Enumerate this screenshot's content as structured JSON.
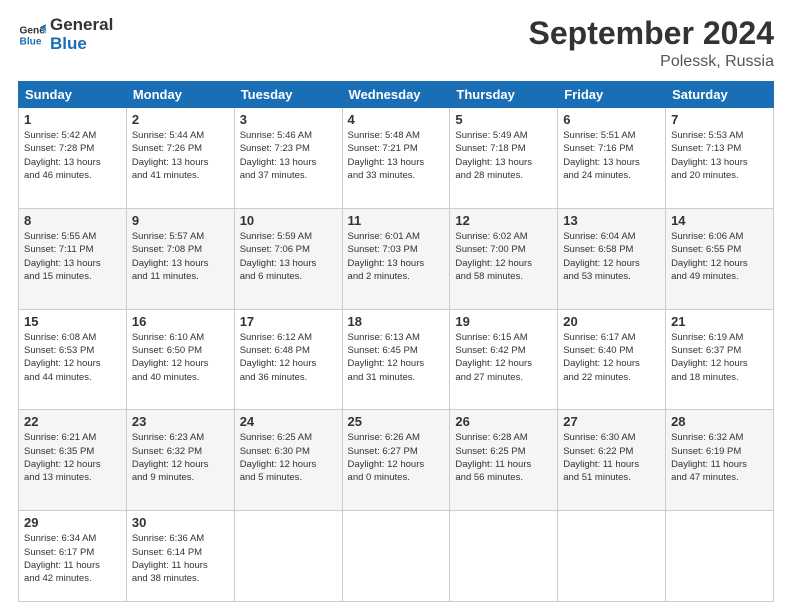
{
  "logo": {
    "line1": "General",
    "line2": "Blue"
  },
  "title": "September 2024",
  "location": "Polessk, Russia",
  "days_of_week": [
    "Sunday",
    "Monday",
    "Tuesday",
    "Wednesday",
    "Thursday",
    "Friday",
    "Saturday"
  ],
  "weeks": [
    [
      {
        "day": "1",
        "info": "Sunrise: 5:42 AM\nSunset: 7:28 PM\nDaylight: 13 hours\nand 46 minutes."
      },
      {
        "day": "2",
        "info": "Sunrise: 5:44 AM\nSunset: 7:26 PM\nDaylight: 13 hours\nand 41 minutes."
      },
      {
        "day": "3",
        "info": "Sunrise: 5:46 AM\nSunset: 7:23 PM\nDaylight: 13 hours\nand 37 minutes."
      },
      {
        "day": "4",
        "info": "Sunrise: 5:48 AM\nSunset: 7:21 PM\nDaylight: 13 hours\nand 33 minutes."
      },
      {
        "day": "5",
        "info": "Sunrise: 5:49 AM\nSunset: 7:18 PM\nDaylight: 13 hours\nand 28 minutes."
      },
      {
        "day": "6",
        "info": "Sunrise: 5:51 AM\nSunset: 7:16 PM\nDaylight: 13 hours\nand 24 minutes."
      },
      {
        "day": "7",
        "info": "Sunrise: 5:53 AM\nSunset: 7:13 PM\nDaylight: 13 hours\nand 20 minutes."
      }
    ],
    [
      {
        "day": "8",
        "info": "Sunrise: 5:55 AM\nSunset: 7:11 PM\nDaylight: 13 hours\nand 15 minutes."
      },
      {
        "day": "9",
        "info": "Sunrise: 5:57 AM\nSunset: 7:08 PM\nDaylight: 13 hours\nand 11 minutes."
      },
      {
        "day": "10",
        "info": "Sunrise: 5:59 AM\nSunset: 7:06 PM\nDaylight: 13 hours\nand 6 minutes."
      },
      {
        "day": "11",
        "info": "Sunrise: 6:01 AM\nSunset: 7:03 PM\nDaylight: 13 hours\nand 2 minutes."
      },
      {
        "day": "12",
        "info": "Sunrise: 6:02 AM\nSunset: 7:00 PM\nDaylight: 12 hours\nand 58 minutes."
      },
      {
        "day": "13",
        "info": "Sunrise: 6:04 AM\nSunset: 6:58 PM\nDaylight: 12 hours\nand 53 minutes."
      },
      {
        "day": "14",
        "info": "Sunrise: 6:06 AM\nSunset: 6:55 PM\nDaylight: 12 hours\nand 49 minutes."
      }
    ],
    [
      {
        "day": "15",
        "info": "Sunrise: 6:08 AM\nSunset: 6:53 PM\nDaylight: 12 hours\nand 44 minutes."
      },
      {
        "day": "16",
        "info": "Sunrise: 6:10 AM\nSunset: 6:50 PM\nDaylight: 12 hours\nand 40 minutes."
      },
      {
        "day": "17",
        "info": "Sunrise: 6:12 AM\nSunset: 6:48 PM\nDaylight: 12 hours\nand 36 minutes."
      },
      {
        "day": "18",
        "info": "Sunrise: 6:13 AM\nSunset: 6:45 PM\nDaylight: 12 hours\nand 31 minutes."
      },
      {
        "day": "19",
        "info": "Sunrise: 6:15 AM\nSunset: 6:42 PM\nDaylight: 12 hours\nand 27 minutes."
      },
      {
        "day": "20",
        "info": "Sunrise: 6:17 AM\nSunset: 6:40 PM\nDaylight: 12 hours\nand 22 minutes."
      },
      {
        "day": "21",
        "info": "Sunrise: 6:19 AM\nSunset: 6:37 PM\nDaylight: 12 hours\nand 18 minutes."
      }
    ],
    [
      {
        "day": "22",
        "info": "Sunrise: 6:21 AM\nSunset: 6:35 PM\nDaylight: 12 hours\nand 13 minutes."
      },
      {
        "day": "23",
        "info": "Sunrise: 6:23 AM\nSunset: 6:32 PM\nDaylight: 12 hours\nand 9 minutes."
      },
      {
        "day": "24",
        "info": "Sunrise: 6:25 AM\nSunset: 6:30 PM\nDaylight: 12 hours\nand 5 minutes."
      },
      {
        "day": "25",
        "info": "Sunrise: 6:26 AM\nSunset: 6:27 PM\nDaylight: 12 hours\nand 0 minutes."
      },
      {
        "day": "26",
        "info": "Sunrise: 6:28 AM\nSunset: 6:25 PM\nDaylight: 11 hours\nand 56 minutes."
      },
      {
        "day": "27",
        "info": "Sunrise: 6:30 AM\nSunset: 6:22 PM\nDaylight: 11 hours\nand 51 minutes."
      },
      {
        "day": "28",
        "info": "Sunrise: 6:32 AM\nSunset: 6:19 PM\nDaylight: 11 hours\nand 47 minutes."
      }
    ],
    [
      {
        "day": "29",
        "info": "Sunrise: 6:34 AM\nSunset: 6:17 PM\nDaylight: 11 hours\nand 42 minutes."
      },
      {
        "day": "30",
        "info": "Sunrise: 6:36 AM\nSunset: 6:14 PM\nDaylight: 11 hours\nand 38 minutes."
      },
      {
        "day": "",
        "info": ""
      },
      {
        "day": "",
        "info": ""
      },
      {
        "day": "",
        "info": ""
      },
      {
        "day": "",
        "info": ""
      },
      {
        "day": "",
        "info": ""
      }
    ]
  ]
}
